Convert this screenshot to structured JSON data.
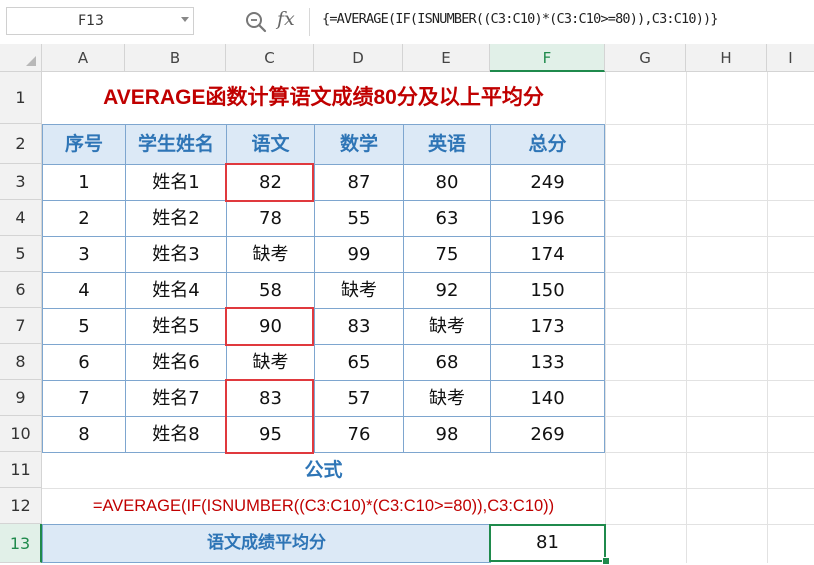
{
  "formula_bar": {
    "name_box": "F13",
    "zoom_icon": "magnifier-icon",
    "fx_label": "fx",
    "formula": "{=AVERAGE(IF(ISNUMBER((C3:C10)*(C3:C10>=80)),C3:C10))}"
  },
  "columns": [
    "A",
    "B",
    "C",
    "D",
    "E",
    "F",
    "G",
    "H",
    "I"
  ],
  "active_column": "F",
  "rows": [
    "1",
    "2",
    "3",
    "4",
    "5",
    "6",
    "7",
    "8",
    "9",
    "10",
    "11",
    "12",
    "13"
  ],
  "active_row": "13",
  "sheet": {
    "title": "AVERAGE函数计算语文成绩80分及以上平均分",
    "headers": [
      "序号",
      "学生姓名",
      "语文",
      "数学",
      "英语",
      "总分"
    ],
    "data": [
      [
        "1",
        "姓名1",
        "82",
        "87",
        "80",
        "249"
      ],
      [
        "2",
        "姓名2",
        "78",
        "55",
        "63",
        "196"
      ],
      [
        "3",
        "姓名3",
        "缺考",
        "99",
        "75",
        "174"
      ],
      [
        "4",
        "姓名4",
        "58",
        "缺考",
        "92",
        "150"
      ],
      [
        "5",
        "姓名5",
        "90",
        "83",
        "缺考",
        "173"
      ],
      [
        "6",
        "姓名6",
        "缺考",
        "65",
        "68",
        "133"
      ],
      [
        "7",
        "姓名7",
        "83",
        "57",
        "缺考",
        "140"
      ],
      [
        "8",
        "姓名8",
        "95",
        "76",
        "98",
        "269"
      ]
    ],
    "formula_label": "公式",
    "formula_text": "=AVERAGE(IF(ISNUMBER((C3:C10)*(C3:C10>=80)),C3:C10))",
    "result_label": "语文成绩平均分",
    "result_value": "81"
  },
  "colors": {
    "title_red": "#c00000",
    "header_blue": "#2e75b6",
    "header_fill": "#dce9f6",
    "selection_green": "#1f8a4c",
    "highlight_red": "#e0393e"
  }
}
